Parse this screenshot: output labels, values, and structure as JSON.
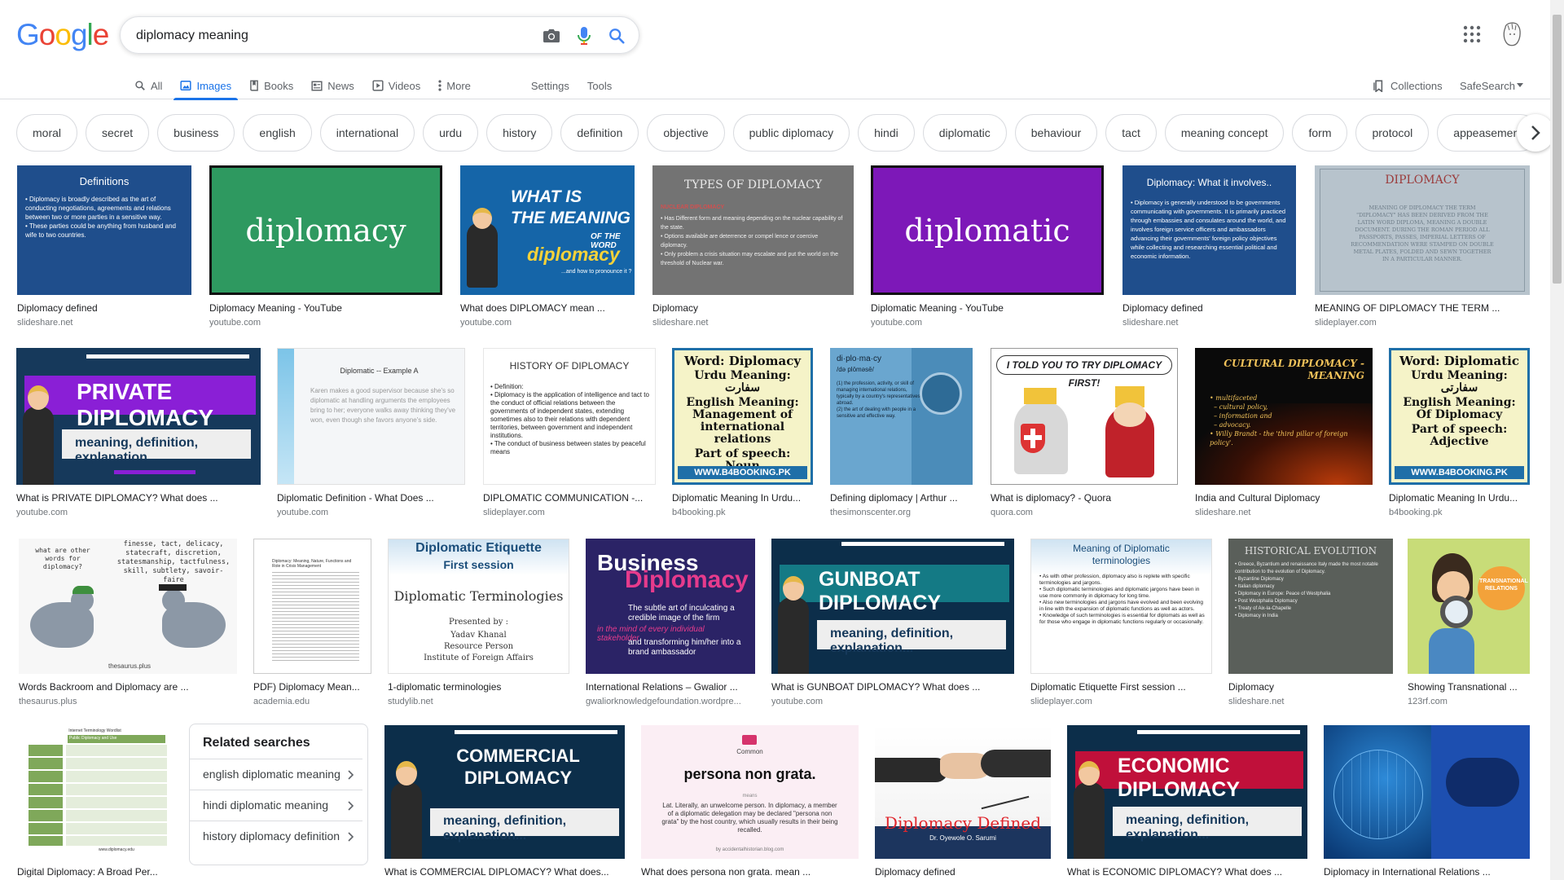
{
  "logo": {
    "letters": [
      "G",
      "o",
      "o",
      "g",
      "l",
      "e"
    ],
    "colors": [
      "#4285f4",
      "#ea4335",
      "#fbbc05",
      "#4285f4",
      "#34a853",
      "#ea4335"
    ]
  },
  "search": {
    "query": "diplomacy meaning",
    "camera_icon": "camera-icon",
    "mic_icon": "mic-icon",
    "search_icon": "search-icon"
  },
  "nav": {
    "tabs": [
      {
        "label": "All",
        "icon": "search-icon"
      },
      {
        "label": "Images",
        "icon": "image-icon"
      },
      {
        "label": "Books",
        "icon": "book-icon"
      },
      {
        "label": "News",
        "icon": "news-icon"
      },
      {
        "label": "Videos",
        "icon": "play-icon"
      },
      {
        "label": "More",
        "icon": "more-vert-icon"
      }
    ],
    "settings": "Settings",
    "tools": "Tools",
    "collections": "Collections",
    "safesearch": "SafeSearch"
  },
  "chips": [
    "moral",
    "secret",
    "business",
    "english",
    "international",
    "urdu",
    "history",
    "definition",
    "objective",
    "public diplomacy",
    "hindi",
    "diplomatic",
    "behaviour",
    "tact",
    "meaning concept",
    "form",
    "protocol",
    "appeasement"
  ],
  "results": [
    {
      "title": "Diplomacy defined",
      "source": "slideshare.net",
      "thumb": {
        "heading": "Definitions",
        "text": "• Diplomacy is broadly described as the art of conducting negotiations, agreements and relations between two or more parties in a sensitive way.\n• These parties could be anything from husband and wife to two countries."
      }
    },
    {
      "title": "Diplomacy Meaning - YouTube",
      "source": "youtube.com",
      "thumb": {
        "text": "diplomacy"
      }
    },
    {
      "title": "What does DIPLOMACY mean ...",
      "source": "youtube.com",
      "thumb": {
        "line1": "WHAT IS",
        "line2": "THE MEANING",
        "line3": "OF THE WORD",
        "line4": "diplomacy",
        "line5": "...and how to pronounce it ?"
      }
    },
    {
      "title": "Diplomacy",
      "source": "slideshare.net",
      "thumb": {
        "heading": "TYPES OF DIPLOMACY",
        "sub": "NUCLEAR DIPLOMACY",
        "text": "• Has Different form and meaning depending on the nuclear capability of the state.\n• Options available are deterrence or compel lence or coercive diplomacy.\n• Only problem a crisis situation may escalate and put the world on the threshold of Nuclear war."
      }
    },
    {
      "title": "Diplomatic Meaning - YouTube",
      "source": "youtube.com",
      "thumb": {
        "text": "diplomatic"
      }
    },
    {
      "title": "Diplomacy defined",
      "source": "slideshare.net",
      "thumb": {
        "heading": "Diplomacy: What it involves..",
        "text": "• Diplomacy is generally understood to be governments communicating with governments. It is primarily practiced through embassies and consulates around the world, and involves foreign service officers and ambassadors advancing their governments' foreign policy objectives while collecting and researching essential political and economic information."
      }
    },
    {
      "title": "MEANING OF DIPLOMACY THE TERM ...",
      "source": "slideplayer.com",
      "thumb": {
        "heading": "DIPLOMACY",
        "text": "MEANING OF DIPLOMACY THE TERM \"DIPLOMACY\" HAS BEEN DERIVED FROM THE LATIN WORD DIPLOMA, MEANING A DOUBLE DOCUMENT. DURING THE ROMAN PERIOD ALL PASSPORTS, PASSES, IMPERIAL LETTERS OF RECOMMENDATION WERE STAMPED ON DOUBLE METAL PLATES, FOLDED AND SEWN TOGETHER IN A PARTICULAR MANNER."
      }
    },
    {
      "title": "What is PRIVATE DIPLOMACY? What does ...",
      "source": "youtube.com",
      "thumb": {
        "banner": "PRIVATE DIPLOMACY",
        "sub": "meaning, definition, explanation..."
      }
    },
    {
      "title": "Diplomatic Definition - What Does ...",
      "source": "youtube.com",
      "thumb": {
        "heading": "Diplomatic -- Example A",
        "text": "Karen makes a good supervisor because she's so diplomatic at handling arguments the employees bring to her; everyone walks away thinking they've won, even though she favors anyone's side."
      }
    },
    {
      "title": "DIPLOMATIC COMMUNICATION -...",
      "source": "slideplayer.com",
      "thumb": {
        "heading": "HISTORY OF DIPLOMACY",
        "text": "• Definition:\n• Diplomacy is the application of intelligence and tact to the conduct of official relations between the governments of independent states, extending sometimes also to their relations with dependent territories, between government and independent institutions.\n• The conduct of business between states by peaceful means"
      }
    },
    {
      "title": "Diplomatic Meaning In Urdu...",
      "source": "b4booking.pk",
      "thumb": {
        "l1": "Word: Diplomacy",
        "l2": "Urdu Meaning: سفارت",
        "l3": "English Meaning: Management of international relations",
        "l4": "Part of speech: Noun",
        "l5": "WWW.B4BOOKING.PK"
      }
    },
    {
      "title": "Defining diplomacy | Arthur ...",
      "source": "thesimonscenter.org",
      "thumb": {
        "heading": "di·plo·ma·cy",
        "sub": "/də plōməsē/",
        "text": "(1) the profession, activity, or skill of managing international relations, typically by a country's representatives abroad.\n(2) the art of dealing with people in a sensitive and effective way."
      }
    },
    {
      "title": "What is diplomacy? - Quora",
      "source": "quora.com",
      "thumb": {
        "text": "I TOLD YOU TO TRY DIPLOMACY FIRST!"
      }
    },
    {
      "title": "India and Cultural Diplomacy",
      "source": "slideshare.net",
      "thumb": {
        "heading": "CULTURAL DIPLOMACY - MEANING",
        "text": "• multifaceted\n  – cultural policy,\n  – information and\n  – advocacy.\n• Willy Brandt - the 'third pillar of foreign policy'."
      }
    },
    {
      "title": "Diplomatic Meaning In Urdu...",
      "source": "b4booking.pk",
      "thumb": {
        "l1": "Word: Diplomatic",
        "l2": "Urdu Meaning: سفارتی",
        "l3": "English Meaning: Of Diplomacy",
        "l4": "Part of speech: Adjective",
        "l5": "WWW.B4BOOKING.PK"
      }
    },
    {
      "title": "Words Backroom and Diplomacy are ...",
      "source": "thesaurus.plus",
      "thumb": {
        "q": "what are other words for diplomacy?",
        "words": "finesse, tact, delicacy, statecraft, discretion, statesmanship, tactfulness, skill, subtlety, savoir-faire",
        "brand": "thesaurus.plus"
      }
    },
    {
      "title": "PDF) Diplomacy Mean...",
      "source": "academia.edu",
      "thumb": {
        "text": "Diplomacy: Meaning, Nature, Functions and Role in Crisis Management"
      }
    },
    {
      "title": "1-diplomatic terminologies",
      "source": "studylib.net",
      "thumb": {
        "l1": "Diplomatic Etiquette",
        "l2": "First session",
        "l3": "Diplomatic Terminologies",
        "l4": "Presented by :",
        "l5": "Yadav Khanal",
        "l6": "Resource Person",
        "l7": "Institute of Foreign Affairs"
      }
    },
    {
      "title": "International Relations – Gwalior ...",
      "source": "gwaliorknowledgefoundation.wordpre...",
      "thumb": {
        "l1": "Business",
        "l2": "Diplomacy",
        "l3": "The subtle art of inculcating a credible image of the firm",
        "l4": "in the mind of every individual stakeholder",
        "l5": "and transforming him/her into a brand ambassador"
      }
    },
    {
      "title": "What is GUNBOAT DIPLOMACY? What does ...",
      "source": "youtube.com",
      "thumb": {
        "banner": "GUNBOAT DIPLOMACY",
        "sub": "meaning, definition, explanation..."
      }
    },
    {
      "title": "Diplomatic Etiquette First session ...",
      "source": "slideplayer.com",
      "thumb": {
        "heading": "Meaning of Diplomatic terminologies",
        "text": "• As with other profession, diplomacy also is replete with specific terminologies and jargons.\n• Such diplomatic terminologies and diplomatic jargons have been in use more commonly in diplomacy for long time.\n• Also new terminologies and jargons have evolved and been evolving in line with the expansion of diplomatic functions as well as actors.\n• Knowledge of such terminologies is essential for diplomats as well as for those who engage in diplomatic functions regularly or occasionally."
      }
    },
    {
      "title": "Diplomacy",
      "source": "slideshare.net",
      "thumb": {
        "heading": "HISTORICAL EVOLUTION",
        "text": "• Greece, Byzantium and renaissance Italy made the most notable contribution to the evolution of Diplomacy.\n• Byzantine Diplomacy\n• Italian diplomacy\n• Diplomacy in Europe: Peace of Westphalia\n• Post Westphalia Diplomacy\n• Treaty of Aix-la-Chapelle\n• Diplomacy in India"
      }
    },
    {
      "title": "Showing Transnational ...",
      "source": "123rf.com",
      "thumb": {
        "text": "TRANSNATIONAL RELATIONS"
      }
    },
    {
      "title": "Digital Diplomacy: A Broad Per...",
      "source": "",
      "thumb": {
        "heading": "Internet Terminology Wordlist",
        "sub": "Public Diplomacy and Use",
        "brand": "www.diplomacy.edu"
      }
    },
    {
      "title": "What is COMMERCIAL DIPLOMACY? What does...",
      "source": "",
      "thumb": {
        "banner": "COMMERCIAL DIPLOMACY",
        "sub": "meaning, definition, explanation..."
      }
    },
    {
      "title": "What does persona non grata. mean ...",
      "source": "",
      "thumb": {
        "tag": "Common",
        "heading": "persona non grata.",
        "means": "means",
        "text": "Lat. Literally, an unwelcome person. In diplomacy, a member of a diplomatic delegation may be declared \"persona non grata\" by the host country, which usually results in their being recalled.",
        "brand": "by accidentalhistorian.blog.com"
      }
    },
    {
      "title": "Diplomacy defined",
      "source": "",
      "thumb": {
        "heading": "Diplomacy Defined",
        "sub": "Dr. Oyewole O. Sarumi"
      }
    },
    {
      "title": "What is ECONOMIC DIPLOMACY? What does ...",
      "source": "",
      "thumb": {
        "banner": "ECONOMIC DIPLOMACY",
        "sub": "meaning, definition, explanation..."
      }
    },
    {
      "title": "Diplomacy in International Relations ...",
      "source": "",
      "thumb": {}
    }
  ],
  "related": {
    "title": "Related searches",
    "items": [
      "english diplomatic meaning",
      "hindi diplomatic meaning",
      "history diplomacy definition"
    ]
  }
}
